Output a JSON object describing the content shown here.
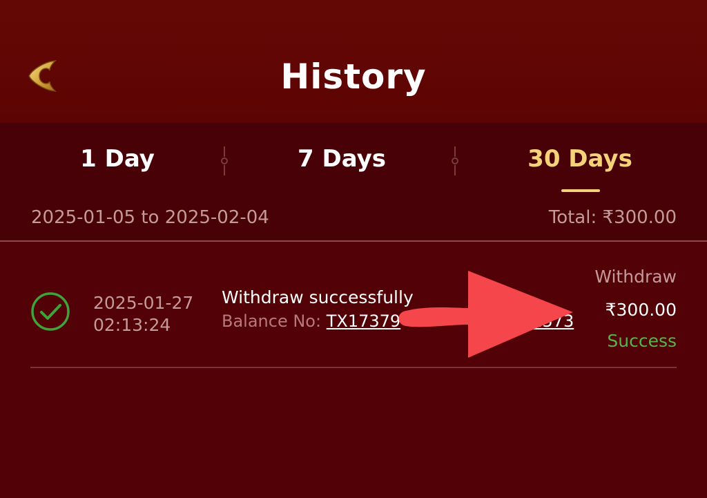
{
  "header": {
    "title": "History",
    "back_icon": "back-chevron-icon"
  },
  "tabs": [
    {
      "label": "1 Day",
      "active": false
    },
    {
      "label": "7 Days",
      "active": false
    },
    {
      "label": "30 Days",
      "active": true
    }
  ],
  "summary": {
    "date_range": "2025-01-05 to 2025-02-04",
    "total": "Total: ₹300.00"
  },
  "records": [
    {
      "status_icon": "success-check-icon",
      "date": "2025-01-27",
      "time": "02:13:24",
      "description": "Withdraw successfully",
      "balance_label": "Balance No:",
      "balance_no": "TX17379",
      "balance_no_suffix": "1573",
      "type": "Withdraw",
      "amount": "₹300.00",
      "status": "Success"
    }
  ],
  "colors": {
    "background": "#520106",
    "header": "#650805",
    "tab_active": "#f3d27a",
    "success": "#58b44a",
    "annotation_arrow": "#f5464b"
  }
}
